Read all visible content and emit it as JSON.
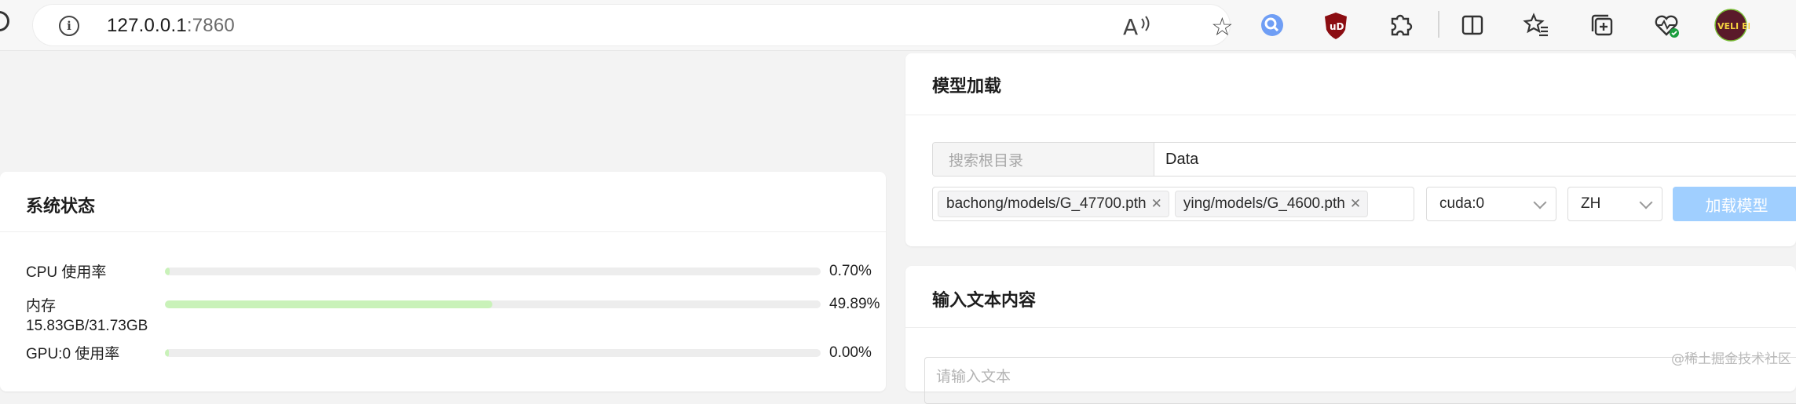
{
  "browser": {
    "url_host": "127.0.0.1",
    "url_port": ":7860",
    "read_aloud_glyph": "A",
    "star_glyph": "☆",
    "extension_icons": [
      "search-extension-icon",
      "ublock-icon",
      "extensions-puzzle-icon",
      "split-screen-icon",
      "favorites-icon",
      "collections-icon",
      "browser-essentials-icon",
      "profile-avatar-icon"
    ],
    "ublock_label": "uD",
    "avatar_label": "VELI EN"
  },
  "system_status": {
    "title": "系统状态",
    "rows": [
      {
        "label": "CPU 使用率",
        "value": "0.70%",
        "fraction": 0.007
      },
      {
        "label": "内存",
        "sub": "15.83GB/31.73GB",
        "value": "49.89%",
        "fraction": 0.4989
      },
      {
        "label": "GPU:0 使用率",
        "value": "0.00%",
        "fraction": 0.0
      }
    ]
  },
  "model_load": {
    "title": "模型加载",
    "root_placeholder": "搜索根目录",
    "root_value": "Data",
    "selected_models": [
      "bachong/models/G_47700.pth",
      "ying/models/G_4600.pth"
    ],
    "device": "cuda:0",
    "language": "ZH",
    "load_button": "加载模型"
  },
  "text_input": {
    "title": "输入文本内容",
    "placeholder": "请输入文本"
  },
  "watermark": "@稀土掘金技术社区",
  "colors": {
    "progress_fill": "#c9f2b9",
    "load_button": "#a0cfff"
  }
}
